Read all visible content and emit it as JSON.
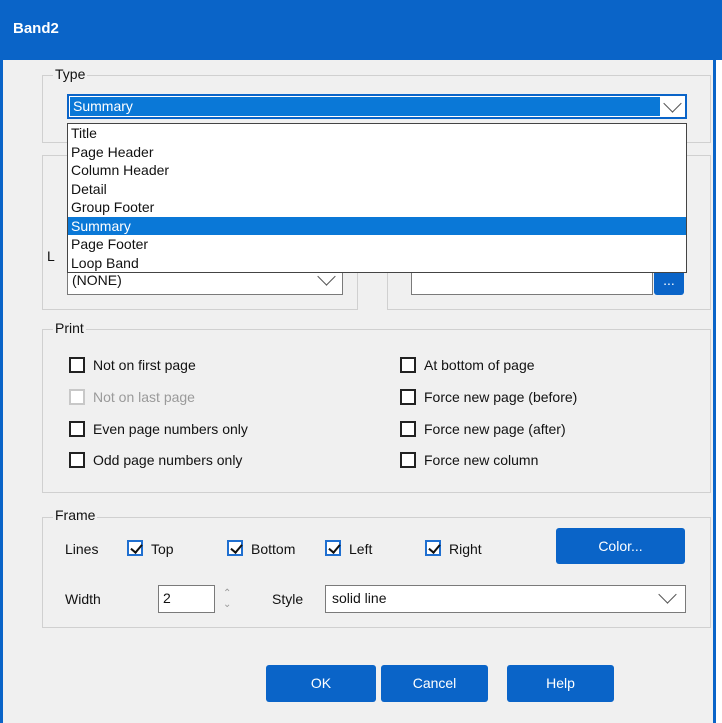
{
  "window": {
    "title": "Band2"
  },
  "type_group": {
    "label": "Type",
    "selected": "Summary",
    "options": [
      "Title",
      "Page Header",
      "Column Header",
      "Detail",
      "Group Footer",
      "Summary",
      "Page Footer",
      "Loop Band"
    ]
  },
  "hidden_group": {
    "label_fragment": "L",
    "left_combo_value": "(NONE)",
    "ellipsis_label": "..."
  },
  "print_group": {
    "label": "Print",
    "left": [
      {
        "label": "Not on first page",
        "checked": false,
        "enabled": true
      },
      {
        "label": "Not on last page",
        "checked": false,
        "enabled": false
      },
      {
        "label": "Even page numbers only",
        "checked": false,
        "enabled": true
      },
      {
        "label": "Odd page numbers only",
        "checked": false,
        "enabled": true
      }
    ],
    "right": [
      {
        "label": "At bottom of page",
        "checked": false,
        "enabled": true
      },
      {
        "label": "Force new page (before)",
        "checked": false,
        "enabled": true
      },
      {
        "label": "Force new page (after)",
        "checked": false,
        "enabled": true
      },
      {
        "label": "Force new column",
        "checked": false,
        "enabled": true
      }
    ]
  },
  "frame_group": {
    "label": "Frame",
    "lines_label": "Lines",
    "lines": [
      {
        "label": "Top",
        "checked": true
      },
      {
        "label": "Bottom",
        "checked": true
      },
      {
        "label": "Left",
        "checked": true
      },
      {
        "label": "Right",
        "checked": true
      }
    ],
    "color_button": "Color...",
    "width_label": "Width",
    "width_value": "2",
    "style_label": "Style",
    "style_value": "solid line"
  },
  "buttons": {
    "ok": "OK",
    "cancel": "Cancel",
    "help": "Help"
  },
  "colors": {
    "accent": "#0a64c8",
    "selection": "#0a78d7"
  }
}
